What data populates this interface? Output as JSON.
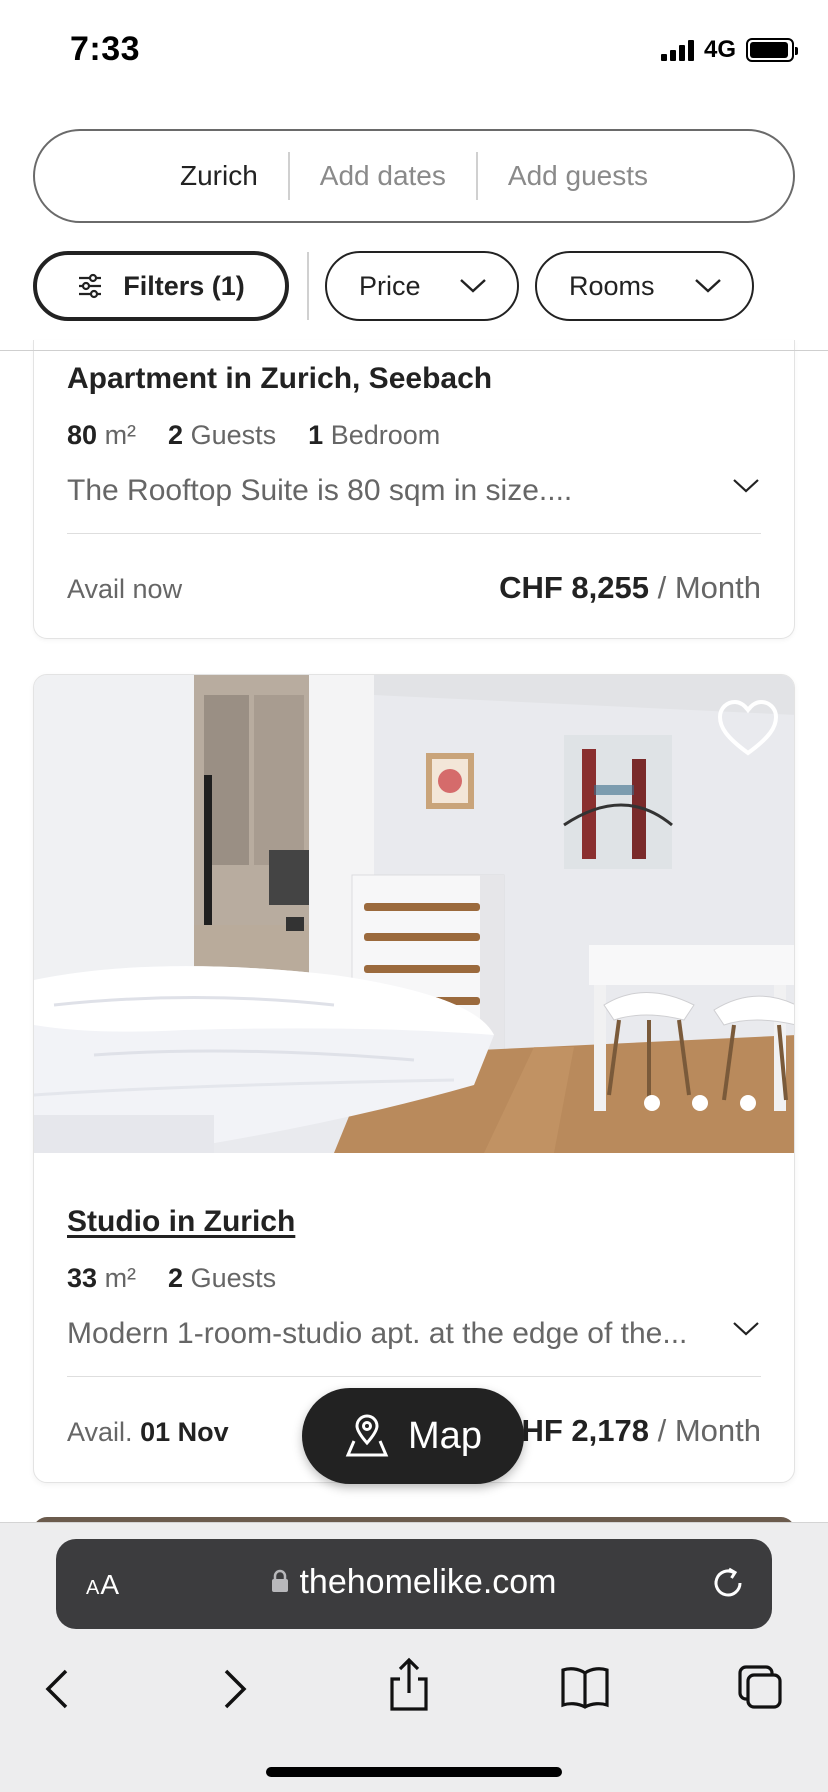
{
  "status_bar": {
    "time": "7:33",
    "network": "4G",
    "battery_level": 0.95
  },
  "search": {
    "location": "Zurich",
    "dates": "Add dates",
    "guests": "Add guests"
  },
  "filters": {
    "filters_label": "Filters (1)",
    "price_label": "Price",
    "rooms_label": "Rooms"
  },
  "listings": [
    {
      "title": "Apartment in Zurich, Seebach",
      "size_value": "80",
      "size_unit": "m²",
      "guests_value": "2",
      "guests_label": "Guests",
      "bedrooms_value": "1",
      "bedrooms_label": "Bedroom",
      "description": "The Rooftop Suite is 80 sqm in size....",
      "availability": "Avail now",
      "price": "CHF 8,255",
      "price_period": "/ Month"
    },
    {
      "title": "Studio in Zurich",
      "size_value": "33",
      "size_unit": "m²",
      "guests_value": "2",
      "guests_label": "Guests",
      "description": "Modern 1-room-studio apt. at the edge of the...",
      "availability_prefix": "Avail.",
      "availability_date": "01 Nov",
      "price": "HF 2,178",
      "price_period": "/ Month",
      "photo_count": 3
    }
  ],
  "map_button": {
    "label": "Map"
  },
  "browser": {
    "text_size_label": "AA",
    "url": "thehomelike.com"
  },
  "icons": {
    "filters": "sliders-icon",
    "dropdown": "chevron-down-icon",
    "favorite": "heart-icon",
    "map": "map-pin-icon",
    "lock": "lock-icon",
    "reload": "reload-icon",
    "back": "chevron-left-icon",
    "forward": "chevron-right-icon",
    "share": "share-icon",
    "bookmarks": "book-icon",
    "tabs": "tabs-icon"
  },
  "colors": {
    "text_primary": "#222222",
    "text_secondary": "#666666",
    "map_button_bg": "#222222",
    "url_bar_bg": "#3c3c3e"
  }
}
